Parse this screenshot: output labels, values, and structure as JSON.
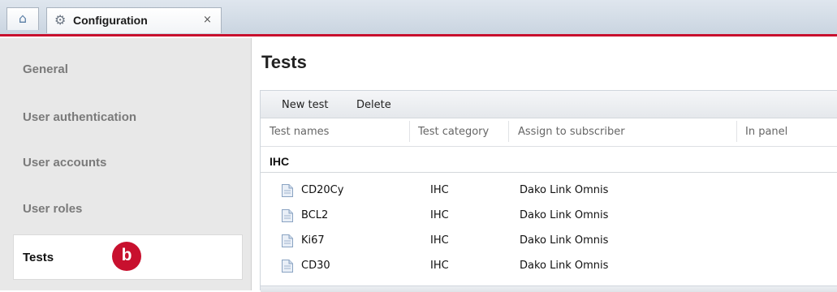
{
  "tabs": {
    "home_icon": "home-icon",
    "config_icon": "gear-icon",
    "active_label": "Configuration",
    "close_glyph": "×"
  },
  "sidebar": {
    "items": [
      {
        "label": "General"
      },
      {
        "label": "User authentication"
      },
      {
        "label": "User accounts"
      },
      {
        "label": "User roles"
      },
      {
        "label": "Tests"
      }
    ],
    "selected_index": 4,
    "callout_label": "b"
  },
  "main": {
    "title": "Tests",
    "toolbar": {
      "new_label": "New test",
      "delete_label": "Delete"
    },
    "columns": [
      "Test names",
      "Test category",
      "Assign to subscriber",
      "In panel"
    ],
    "group_label": "IHC",
    "rows": [
      {
        "name": "CD20Cy",
        "category": "IHC",
        "subscriber": "Dako Link Omnis",
        "panel": ""
      },
      {
        "name": "BCL2",
        "category": "IHC",
        "subscriber": "Dako Link Omnis",
        "panel": ""
      },
      {
        "name": "Ki67",
        "category": "IHC",
        "subscriber": "Dako Link Omnis",
        "panel": ""
      },
      {
        "name": "CD30",
        "category": "IHC",
        "subscriber": "Dako Link Omnis",
        "panel": ""
      }
    ]
  },
  "colors": {
    "accent": "#c8102e",
    "sidebar_bg": "#e8e8e8",
    "toolbar_bg": "#eef0f3"
  }
}
